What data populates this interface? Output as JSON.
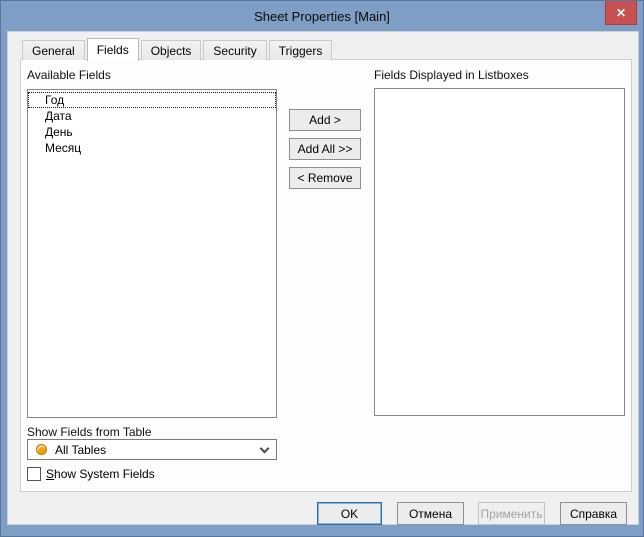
{
  "window": {
    "title": "Sheet Properties [Main]"
  },
  "icons": {
    "close": "✕"
  },
  "tabs": [
    {
      "label": "General"
    },
    {
      "label": "Fields"
    },
    {
      "label": "Objects"
    },
    {
      "label": "Security"
    },
    {
      "label": "Triggers"
    }
  ],
  "fields_tab": {
    "available": {
      "label": "Available Fields",
      "items": [
        "Год",
        "Дата",
        "День",
        "Месяц"
      ],
      "focused_item": "Год"
    },
    "displayed": {
      "label": "Fields Displayed in Listboxes",
      "items": []
    },
    "actions": {
      "add": "Add >",
      "add_all": "Add All >>",
      "remove": "< Remove"
    },
    "table_filter": {
      "label": "Show Fields from Table",
      "value": "All Tables"
    },
    "system_fields": {
      "label_first": "S",
      "label_rest": "how System Fields",
      "checked": false
    }
  },
  "footer": {
    "ok": "OK",
    "cancel": "Отмена",
    "apply": "Применить",
    "help": "Справка"
  },
  "colors": {
    "titlebar": "#7e9ec5",
    "close_button": "#c75050",
    "dialog_bg": "#f0f0f0",
    "page_bg": "#fdfdfd",
    "listbox_border": "#828790",
    "default_button_ring": "#2f6da8",
    "all_tables_dot": "#f0a30a"
  }
}
